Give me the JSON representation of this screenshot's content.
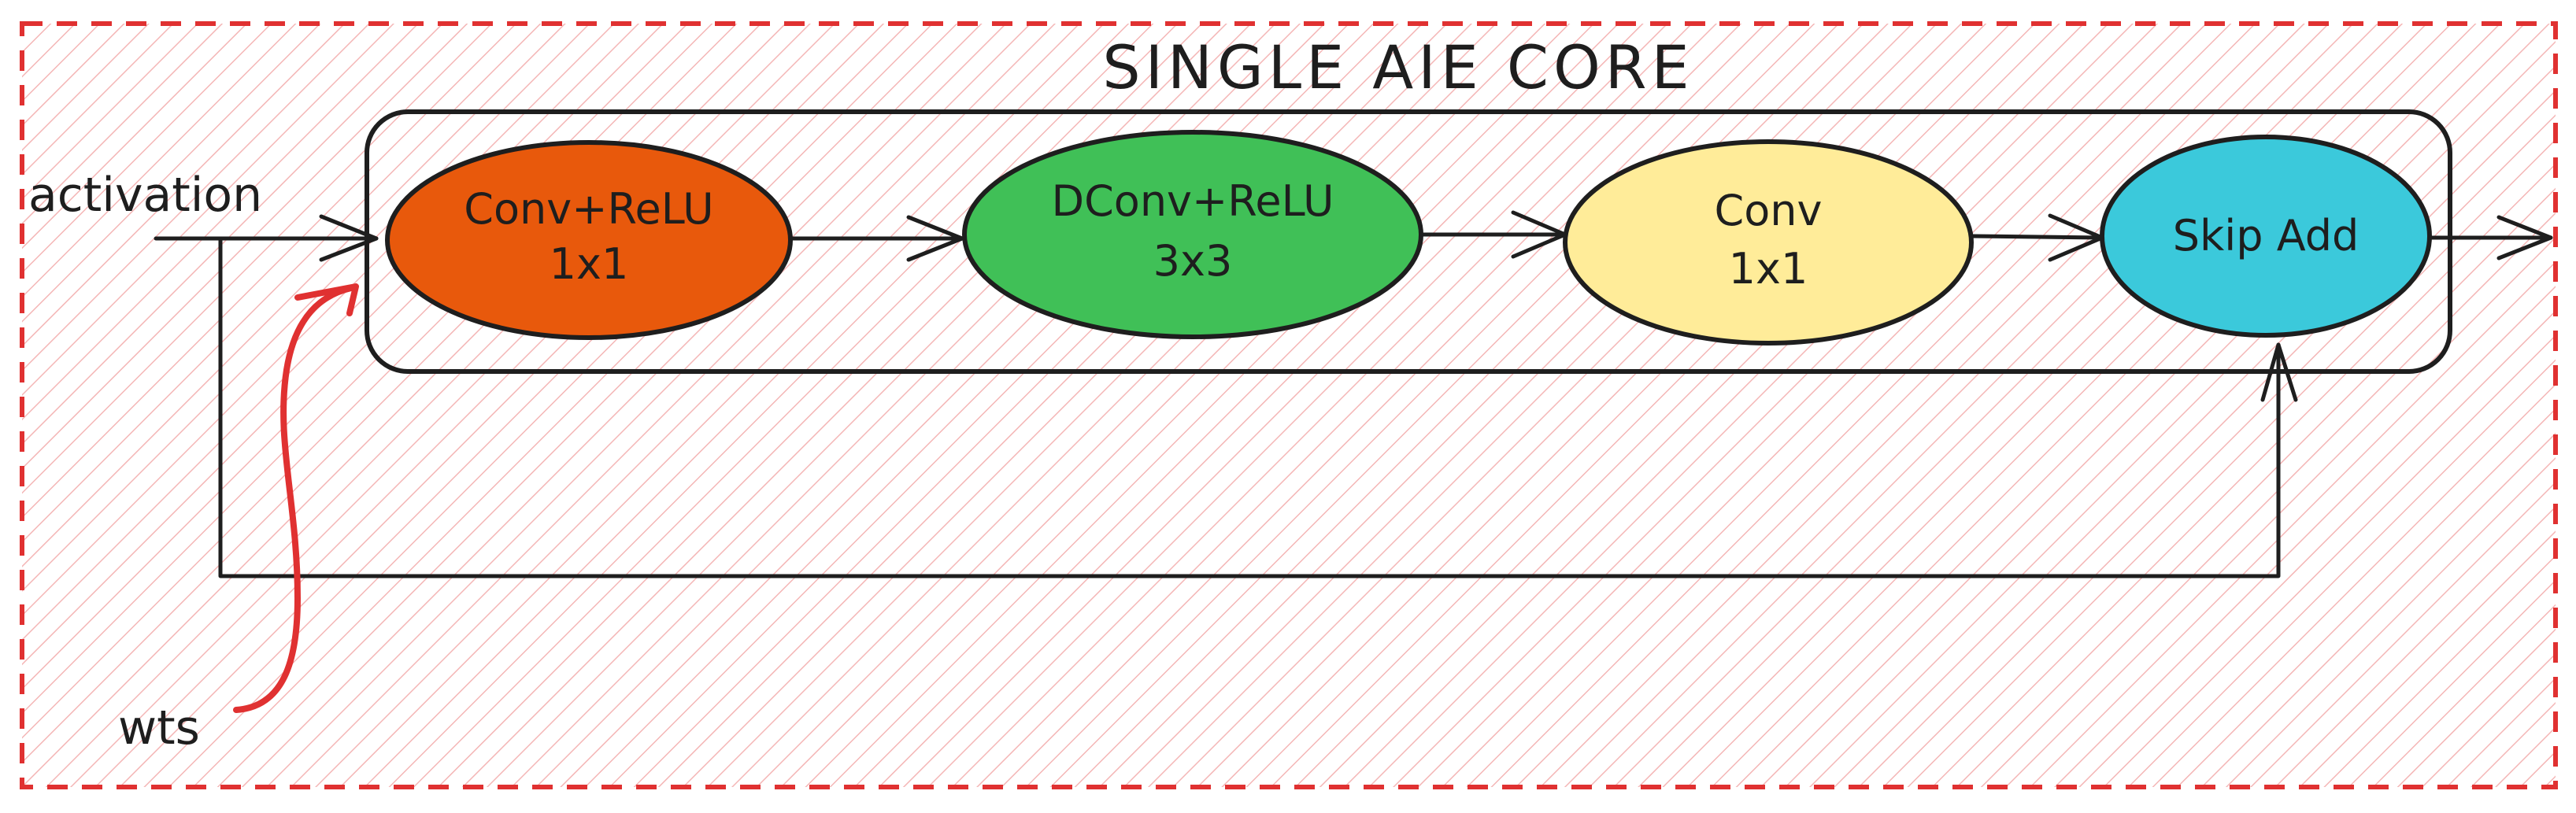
{
  "diagram": {
    "title": "SINGLE AIE CORE",
    "inputs": {
      "activation": "activation",
      "weights": "wts"
    },
    "nodes": [
      {
        "id": "conv-relu-1x1",
        "line1": "Conv+ReLU",
        "line2": "1x1",
        "color": "#e8590c"
      },
      {
        "id": "dconv-relu-3x3",
        "line1": "DConv+ReLU",
        "line2": "3x3",
        "color": "#40c057"
      },
      {
        "id": "conv-1x1",
        "line1": "Conv",
        "line2": "1x1",
        "color": "#ffec99"
      },
      {
        "id": "skip-add",
        "line1": "Skip Add",
        "line2": "",
        "color": "#3bc9db"
      }
    ],
    "colors": {
      "outer_border": "#e03131",
      "weights_arrow": "#e03131",
      "hatch": "#f4b6b6",
      "stroke": "#1e1e1e"
    }
  }
}
